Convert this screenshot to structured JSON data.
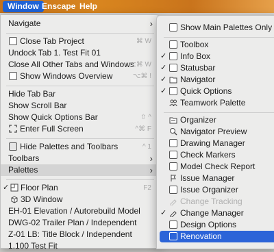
{
  "menubar": {
    "window": "Window",
    "enscape": "Enscape",
    "help": "Help"
  },
  "main_menu": [
    {
      "label": "Navigate",
      "arrow": "›"
    },
    {
      "label": "Close Tab Project",
      "shortcut": "⌘ W",
      "icon": "close-tab-icon"
    },
    {
      "label": "Undock Tab 1. Test Fit 01"
    },
    {
      "label": "Close All Other Tabs and Windows",
      "shortcut": "⌥⌘ W"
    },
    {
      "label": "Show Windows Overview",
      "shortcut": "⌥⌘ !",
      "icon": "windows-overview-icon"
    },
    {
      "label": "Hide Tab Bar"
    },
    {
      "label": "Show Scroll Bar"
    },
    {
      "label": "Show Quick Options Bar",
      "shortcut": "⇧ ^"
    },
    {
      "label": "Enter Full Screen",
      "shortcut": "^⌘ F",
      "icon": "full-screen-icon"
    },
    {
      "label": "Hide Palettes and Toolbars",
      "shortcut": "^ 1",
      "icon": "palettes-toolbars-icon"
    },
    {
      "label": "Toolbars",
      "arrow": "›"
    },
    {
      "label": "Palettes",
      "arrow": "›"
    },
    {
      "label": "Floor Plan",
      "shortcut": "F2",
      "checked": "✓",
      "icon": "floor-plan-icon"
    },
    {
      "label": "3D Window",
      "icon": "3d-window-icon"
    },
    {
      "label": "EH-01 Elevation / Autorebuild Model"
    },
    {
      "label": "DWG-02 Trailer Plan / Independent"
    },
    {
      "label": "Z-01 LB: Title Block / Independent"
    },
    {
      "label": "1.100 Test Fit"
    }
  ],
  "sub_menu": [
    {
      "label": "Show Main Palettes Only"
    },
    {
      "label": "Toolbox"
    },
    {
      "label": "Info Box",
      "checked": "✓"
    },
    {
      "label": "Statusbar",
      "checked": "✓"
    },
    {
      "label": "Navigator",
      "checked": "✓"
    },
    {
      "label": "Quick Options",
      "checked": "✓"
    },
    {
      "label": "Teamwork Palette"
    },
    {
      "label": "Organizer"
    },
    {
      "label": "Navigator Preview"
    },
    {
      "label": "Drawing Manager"
    },
    {
      "label": "Check Markers"
    },
    {
      "label": "Model Check Report"
    },
    {
      "label": "Issue Manager"
    },
    {
      "label": "Issue Organizer"
    },
    {
      "label": "Change Tracking"
    },
    {
      "label": "Change Manager",
      "checked": "✓"
    },
    {
      "label": "Design Options"
    },
    {
      "label": "Renovation"
    }
  ]
}
